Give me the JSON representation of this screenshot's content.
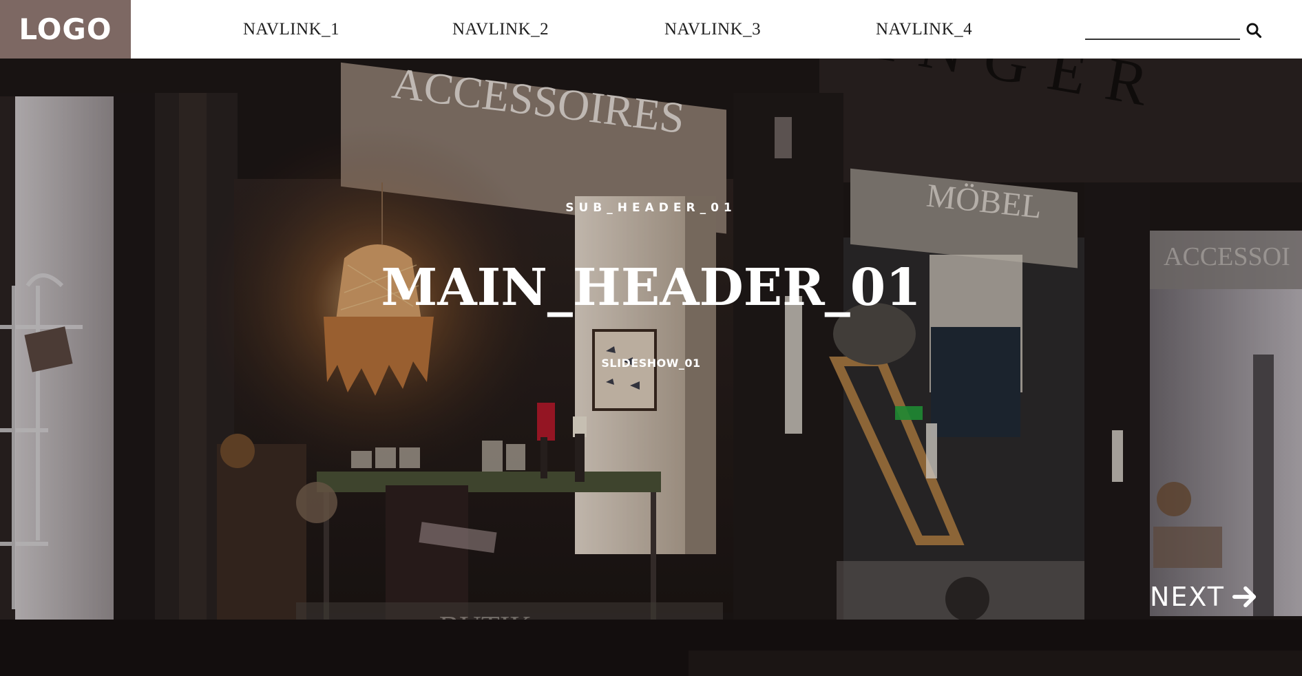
{
  "header": {
    "logo": "LOGO",
    "nav": [
      "NAVLINK_1",
      "NAVLINK_2",
      "NAVLINK_3",
      "NAVLINK_4"
    ],
    "search": {
      "value": "",
      "placeholder": "",
      "icon": "search-icon"
    }
  },
  "hero": {
    "sub_header": "SUB_HEADER_01",
    "main_header": "MAIN_HEADER_01",
    "slideshow_label": "SLIDESHOW_01",
    "next_label": "NEXT",
    "next_icon": "arrow-right-icon"
  },
  "scene_text": {
    "sign_top": "ACCESSOIRES",
    "sign_right": "MÖBEL",
    "sign_building": "INGER",
    "sign_small_right": "ACCESSOI",
    "door_text": "BUTIK"
  },
  "colors": {
    "logo_bg": "#7d6863",
    "header_bg": "#ffffff",
    "nav_text": "#1e1e1e"
  }
}
